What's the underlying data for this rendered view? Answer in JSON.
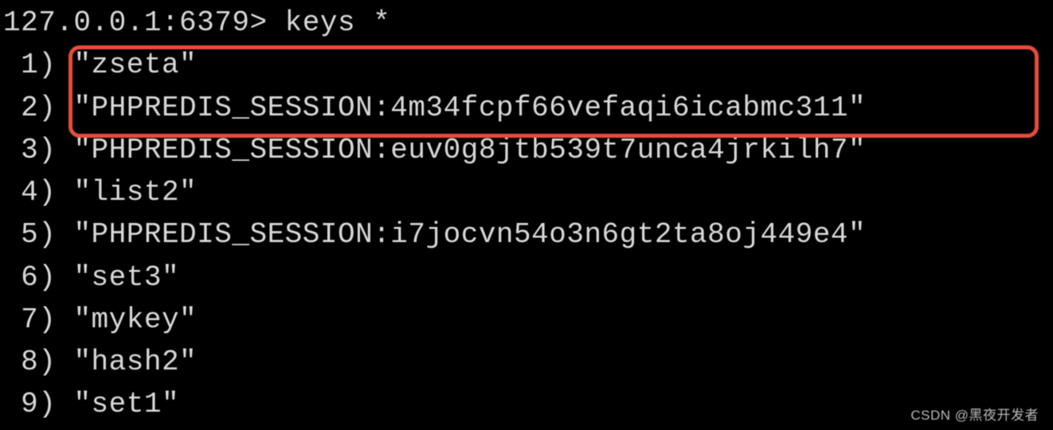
{
  "prompt": "127.0.0.1:6379> keys *",
  "results": [
    {
      "index": " 1",
      "value": "\"zseta\""
    },
    {
      "index": " 2",
      "value": "\"PHPREDIS_SESSION:4m34fcpf66vefaqi6icabmc311\""
    },
    {
      "index": " 3",
      "value": "\"PHPREDIS_SESSION:euv0g8jtb539t7unca4jrkilh7\""
    },
    {
      "index": " 4",
      "value": "\"list2\""
    },
    {
      "index": " 5",
      "value": "\"PHPREDIS_SESSION:i7jocvn54o3n6gt2ta8oj449e4\""
    },
    {
      "index": " 6",
      "value": "\"set3\""
    },
    {
      "index": " 7",
      "value": "\"mykey\""
    },
    {
      "index": " 8",
      "value": "\"hash2\""
    },
    {
      "index": " 9",
      "value": "\"set1\""
    }
  ],
  "watermark": "CSDN @黑夜开发者"
}
